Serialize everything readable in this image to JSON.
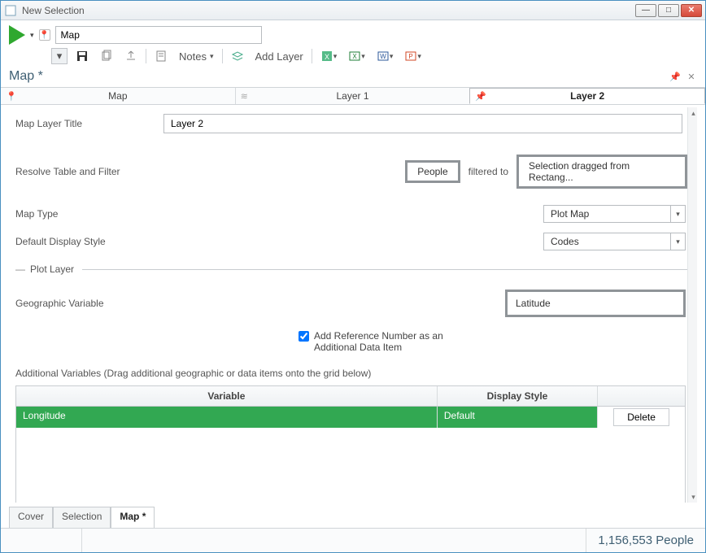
{
  "window": {
    "title": "New Selection"
  },
  "toolbar": {
    "map_input_value": "Map",
    "notes_label": "Notes",
    "add_layer_label": "Add Layer"
  },
  "doc": {
    "title": "Map *"
  },
  "tabs_top": [
    "Map",
    "Layer 1",
    "Layer 2"
  ],
  "form": {
    "title_label": "Map Layer Title",
    "title_value": "Layer 2",
    "resolve_label": "Resolve Table and Filter",
    "people_btn": "People",
    "filtered_to": "filtered to",
    "selection_btn": "Selection dragged from Rectang...",
    "maptype_label": "Map Type",
    "maptype_value": "Plot Map",
    "display_label": "Default Display Style",
    "display_value": "Codes",
    "section_plot": "Plot Layer",
    "geo_label": "Geographic Variable",
    "geo_value": "Latitude",
    "ref_checkbox": "Add Reference Number as an Additional Data Item",
    "addl_hint": "Additional Variables (Drag additional geographic or data items onto the grid below)",
    "grid_headers": {
      "variable": "Variable",
      "display": "Display Style"
    },
    "grid_row": {
      "variable": "Longitude",
      "display": "Default",
      "delete": "Delete"
    }
  },
  "bottom_tabs": [
    "Cover",
    "Selection",
    "Map *"
  ],
  "status": {
    "count_text": "1,156,553 People"
  }
}
